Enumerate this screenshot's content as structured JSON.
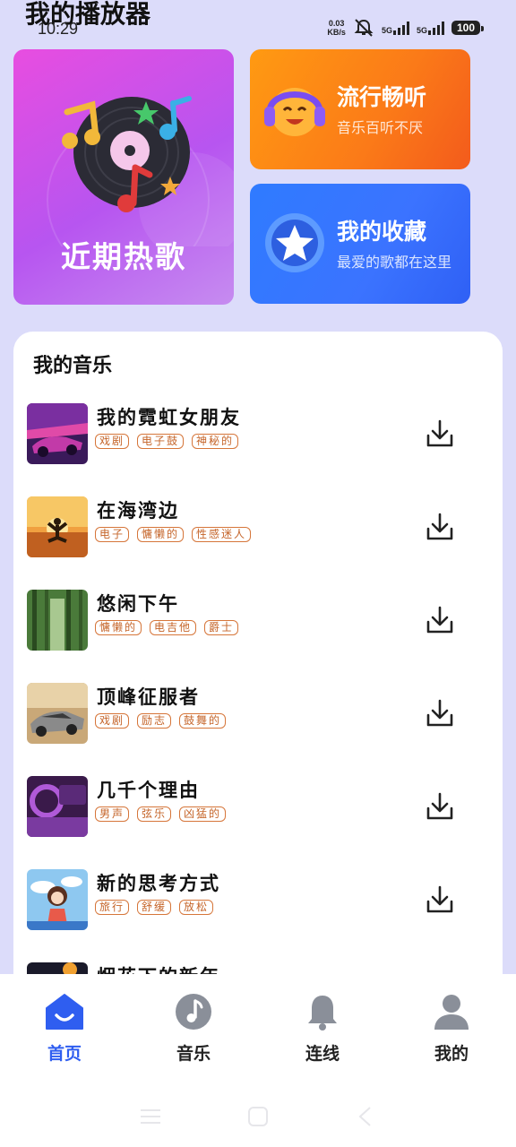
{
  "app": {
    "title": "我的播放器"
  },
  "status_bar": {
    "time": "10:29",
    "net_speed_value": "0.03",
    "net_speed_unit": "KB/s",
    "sim1": "5G",
    "sim2": "5G",
    "battery": "100"
  },
  "cards": {
    "hot": {
      "title": "近期热歌"
    },
    "popular": {
      "title": "流行畅听",
      "subtitle": "音乐百听不厌"
    },
    "favorites": {
      "title": "我的收藏",
      "subtitle": "最爱的歌都在这里"
    }
  },
  "my_music": {
    "title": "我的音乐",
    "songs": [
      {
        "title": "我的霓虹女朋友",
        "tags": [
          "戏剧",
          "电子鼓",
          "神秘的"
        ]
      },
      {
        "title": "在海湾边",
        "tags": [
          "电子",
          "慵懒的",
          "性感迷人"
        ]
      },
      {
        "title": "悠闲下午",
        "tags": [
          "慵懒的",
          "电吉他",
          "爵士"
        ]
      },
      {
        "title": "顶峰征服者",
        "tags": [
          "戏剧",
          "励志",
          "鼓舞的"
        ]
      },
      {
        "title": "几千个理由",
        "tags": [
          "男声",
          "弦乐",
          "凶猛的"
        ]
      },
      {
        "title": "新的思考方式",
        "tags": [
          "旅行",
          "舒缓",
          "放松"
        ]
      },
      {
        "title": "烟花下的新年",
        "tags": []
      }
    ]
  },
  "bottom_nav": {
    "items": [
      {
        "label": "首页"
      },
      {
        "label": "音乐"
      },
      {
        "label": "连线"
      },
      {
        "label": "我的"
      }
    ],
    "active_color": "#2f5ef0",
    "inactive_icon_color": "#8a8f99"
  }
}
